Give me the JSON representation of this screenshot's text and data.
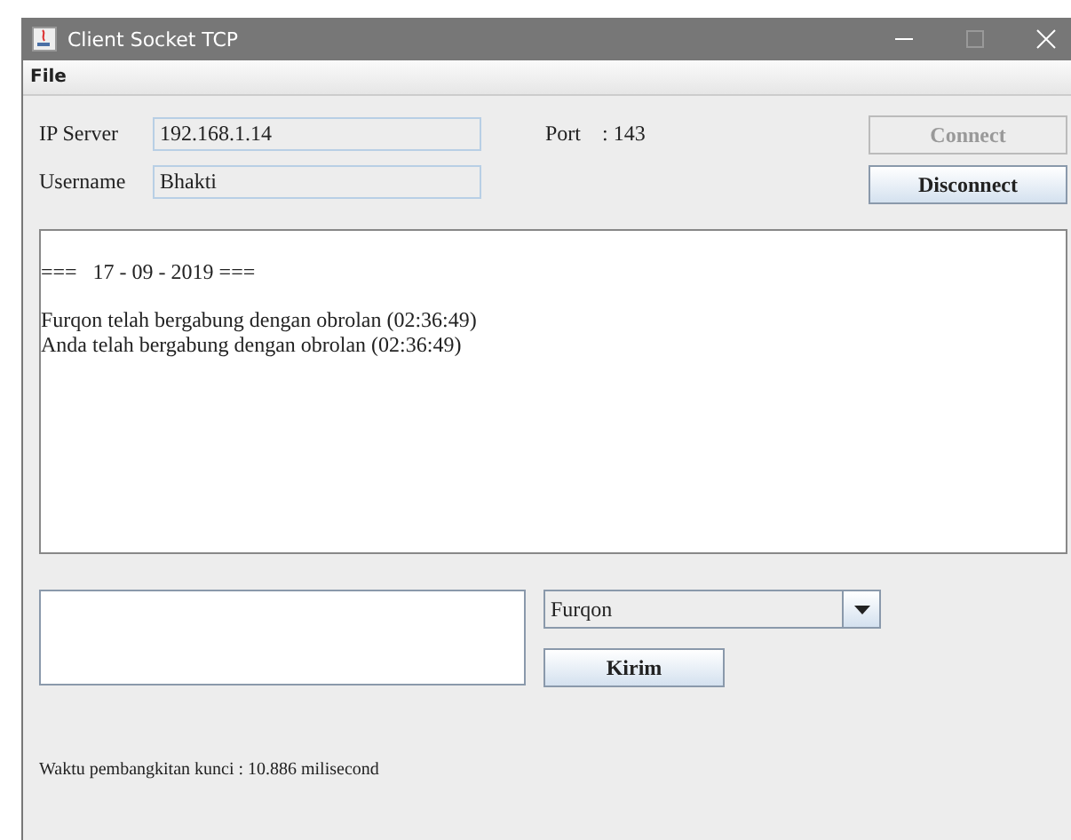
{
  "window": {
    "title": "Client Socket TCP"
  },
  "menu": [
    "File"
  ],
  "connection": {
    "ip_label": "IP Server",
    "ip_value": "192.168.1.14",
    "username_label": "Username",
    "username_value": "Bhakti",
    "port_label": "Port",
    "port_value": ": 143"
  },
  "buttons": [
    {
      "label": "Connect",
      "disabled": true
    },
    {
      "label": "Disconnect",
      "disabled": false
    }
  ],
  "chat": {
    "date_header": "===   17 - 09 - 2019 ===",
    "lines": [
      "Furqon telah bergabung dengan obrolan (02:36:49)",
      "Anda telah bergabung dengan obrolan (02:36:49)"
    ]
  },
  "recipient": {
    "value": "Furqon"
  },
  "send_button": "Kirim",
  "status": "Waktu pembangkitan kunci : 10.886 milisecond"
}
